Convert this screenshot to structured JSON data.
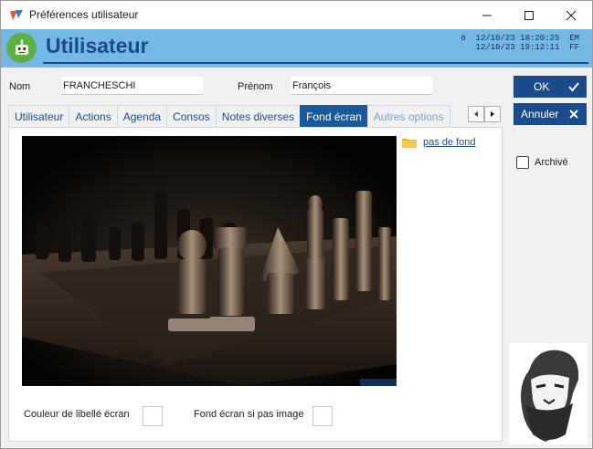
{
  "window": {
    "title": "Préférences utilisateur"
  },
  "header": {
    "title": "Utilisateur",
    "info_line1": "6  12/10/23 18:20:25  EM",
    "info_line2": "   12/10/23 19:12:11  FF"
  },
  "form": {
    "nom_label": "Nom",
    "nom_value": "FRANCHESCHI",
    "prenom_label": "Prénom",
    "prenom_value": "François"
  },
  "tabs": [
    {
      "label": "Utilisateur"
    },
    {
      "label": "Actions"
    },
    {
      "label": "Agenda"
    },
    {
      "label": "Consos"
    },
    {
      "label": "Notes diverses"
    },
    {
      "label": "Fond écran"
    },
    {
      "label": "Autres options"
    }
  ],
  "background": {
    "link": "pas de fond",
    "couleur_label": "Couleur de libellé écran",
    "fond_label": "Fond écran si pas image"
  },
  "buttons": {
    "ok": "OK",
    "cancel": "Annuler"
  },
  "archive": {
    "label": "Archivé",
    "checked": false
  },
  "colors": {
    "accent": "#1a4c8c",
    "header_bg": "#74b9e6",
    "active_tab": "#1a5a99"
  }
}
